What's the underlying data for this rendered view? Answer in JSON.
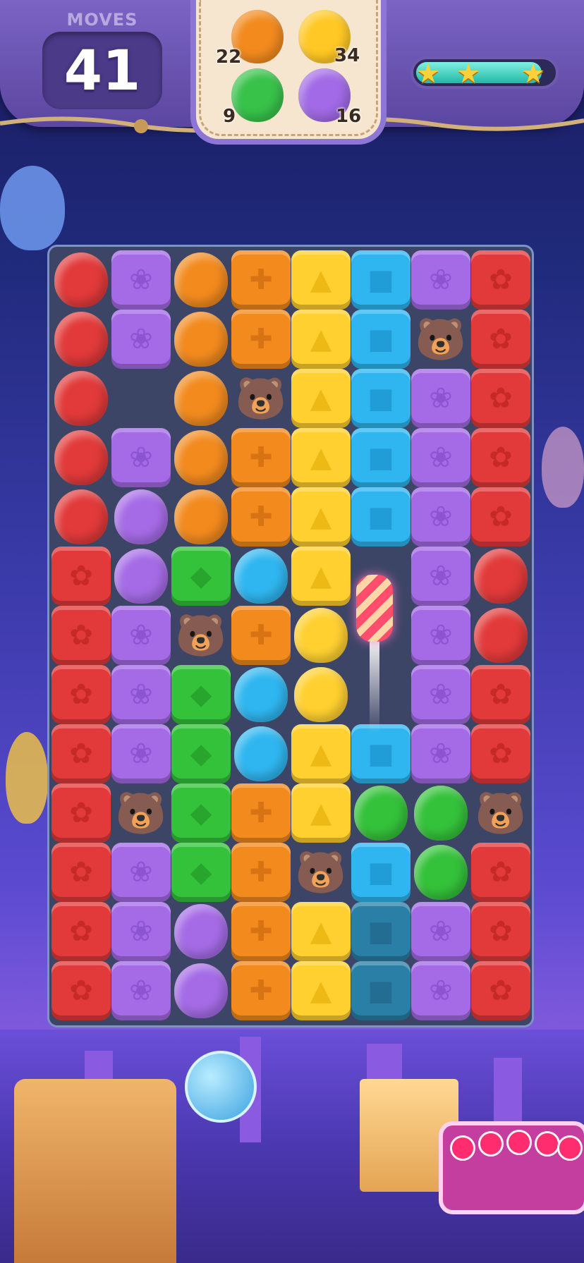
{
  "hud": {
    "moves_label": "MOVES",
    "moves_value": "41",
    "goals": [
      {
        "color": "#f28a1e",
        "count": "22"
      },
      {
        "color": "#ffc824",
        "count": "34"
      },
      {
        "color": "#38c24a",
        "count": "9"
      },
      {
        "color": "#a26ae6",
        "count": "16"
      }
    ],
    "stars_earned": 3,
    "star_progress": 0.92
  },
  "board": {
    "columns": 8,
    "rows": 13,
    "legend": {
      "R": "red-star-block",
      "P": "purple-flower-block",
      "O": "orange-cross-block",
      "Y": "yellow-triangle-block",
      "B": "blue-square-block",
      "G": "green-diamond-block",
      "T": "teal-square-block",
      "r": "red-balloon",
      "o": "orange-balloon",
      "p": "purple-balloon",
      "b": "blue-balloon",
      "y": "yellow-balloon",
      "g": "green-balloon",
      "W": "polar-bear",
      ".": "empty"
    },
    "grid": [
      "rPoOYBPR",
      "rPoOYBWR",
      "r.oWYBPR",
      "rPoOYBPR",
      "rpoOYBPR",
      "RpGbY.Pr",
      "RPWOy.Pr",
      "RPGby.PR",
      "RPGbYBPR",
      "RWGOYggW",
      "RPGOWBgR",
      "RPpOYTPR",
      "RPpOYTPR"
    ],
    "rocket_column": 5,
    "rocket_row": 5
  }
}
